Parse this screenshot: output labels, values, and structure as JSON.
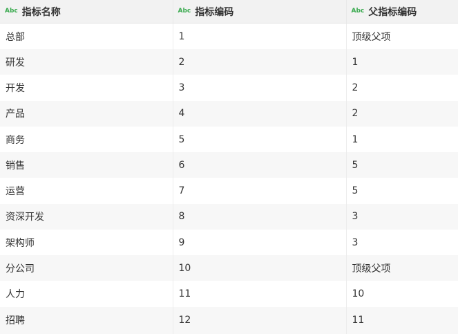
{
  "table": {
    "type_badge": "Abc",
    "columns": [
      "指标名称",
      "指标编码",
      "父指标编码"
    ],
    "rows": [
      [
        "总部",
        "1",
        "顶级父项"
      ],
      [
        "研发",
        "2",
        "1"
      ],
      [
        "开发",
        "3",
        "2"
      ],
      [
        "产品",
        "4",
        "2"
      ],
      [
        "商务",
        "5",
        "1"
      ],
      [
        "销售",
        "6",
        "5"
      ],
      [
        "运营",
        "7",
        "5"
      ],
      [
        "资深开发",
        "8",
        "3"
      ],
      [
        "架构师",
        "9",
        "3"
      ],
      [
        "分公司",
        "10",
        "顶级父项"
      ],
      [
        "人力",
        "11",
        "10"
      ],
      [
        "招聘",
        "12",
        "11"
      ]
    ]
  },
  "colors": {
    "badge": "#3aaa4f",
    "header_bg": "#f2f2f2",
    "row_alt_bg": "#f7f7f7",
    "text": "#333333"
  }
}
